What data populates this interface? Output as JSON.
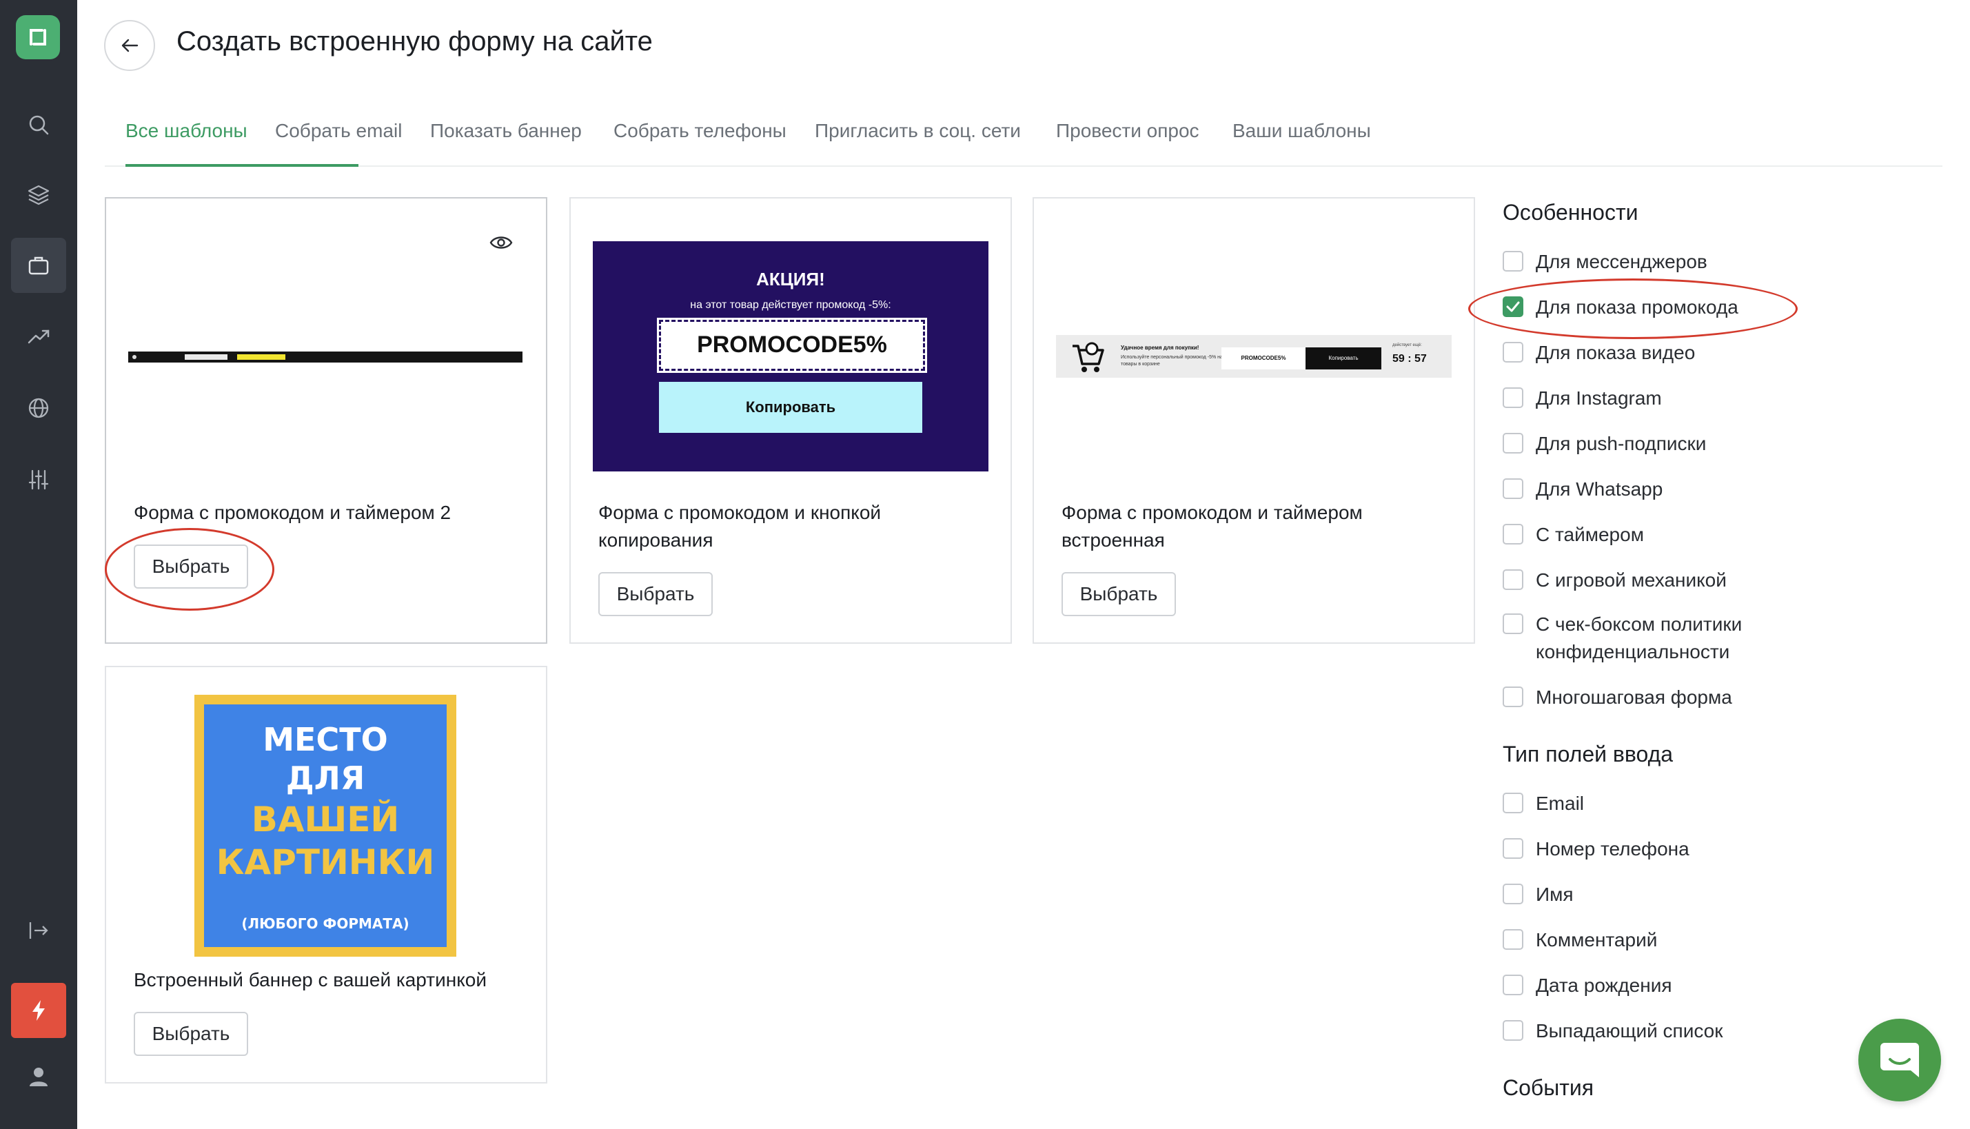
{
  "header": {
    "title": "Создать встроенную форму на сайте"
  },
  "tabs": [
    {
      "label": "Все шаблоны",
      "active": true
    },
    {
      "label": "Собрать email"
    },
    {
      "label": "Показать баннер"
    },
    {
      "label": "Собрать телефоны"
    },
    {
      "label": "Пригласить в соц. сети"
    },
    {
      "label": "Провести опрос"
    },
    {
      "label": "Ваши шаблоны"
    }
  ],
  "cards": [
    {
      "title": "Форма с промокодом и таймером 2",
      "button": "Выбрать"
    },
    {
      "title": "Форма с промокодом и кнопкой копирования",
      "button": "Выбрать",
      "preview": {
        "heading": "АКЦИЯ!",
        "subtext": "на этот товар действует промокод -5%:",
        "code": "PROMOCODE5%",
        "copy": "Копировать"
      }
    },
    {
      "title": "Форма с промокодом и таймером встроенная",
      "button": "Выбрать",
      "preview": {
        "line1": "Удачное время для покупки!",
        "line2": "Используйте персональный промокод -5% на товары в корзине",
        "code": "PROMOCODE5%",
        "copy": "Копировать",
        "timer_label": "действует ещё:",
        "timer": "59 : 57"
      }
    },
    {
      "title": "Встроенный баннер с вашей картинкой",
      "button": "Выбрать",
      "preview": {
        "line1": "МЕСТО",
        "line2": "ДЛЯ",
        "line3": "ВАШЕЙ",
        "line4": "КАРТИНКИ",
        "line5": "(ЛЮБОГО ФОРМАТА)"
      }
    }
  ],
  "filters": {
    "features_title": "Особенности",
    "features": [
      {
        "label": "Для мессенджеров",
        "checked": false
      },
      {
        "label": "Для показа промокода",
        "checked": true
      },
      {
        "label": "Для показа видео",
        "checked": false
      },
      {
        "label": "Для Instagram",
        "checked": false
      },
      {
        "label": "Для push-подписки",
        "checked": false
      },
      {
        "label": "Для Whatsapp",
        "checked": false
      },
      {
        "label": "С таймером",
        "checked": false
      },
      {
        "label": "С игровой механикой",
        "checked": false
      },
      {
        "label": "С чек-боксом политики конфиденциальности",
        "checked": false
      },
      {
        "label": "Многошаговая форма",
        "checked": false
      }
    ],
    "fields_title": "Тип полей ввода",
    "fields": [
      {
        "label": "Email",
        "checked": false
      },
      {
        "label": "Номер телефона",
        "checked": false
      },
      {
        "label": "Имя",
        "checked": false
      },
      {
        "label": "Комментарий",
        "checked": false
      },
      {
        "label": "Дата рождения",
        "checked": false
      },
      {
        "label": "Выпадающий список",
        "checked": false
      }
    ],
    "events_title": "События"
  },
  "colors": {
    "accent": "#3d9b63",
    "sidebar": "#2b2f36",
    "annotation": "#d33a2c"
  }
}
